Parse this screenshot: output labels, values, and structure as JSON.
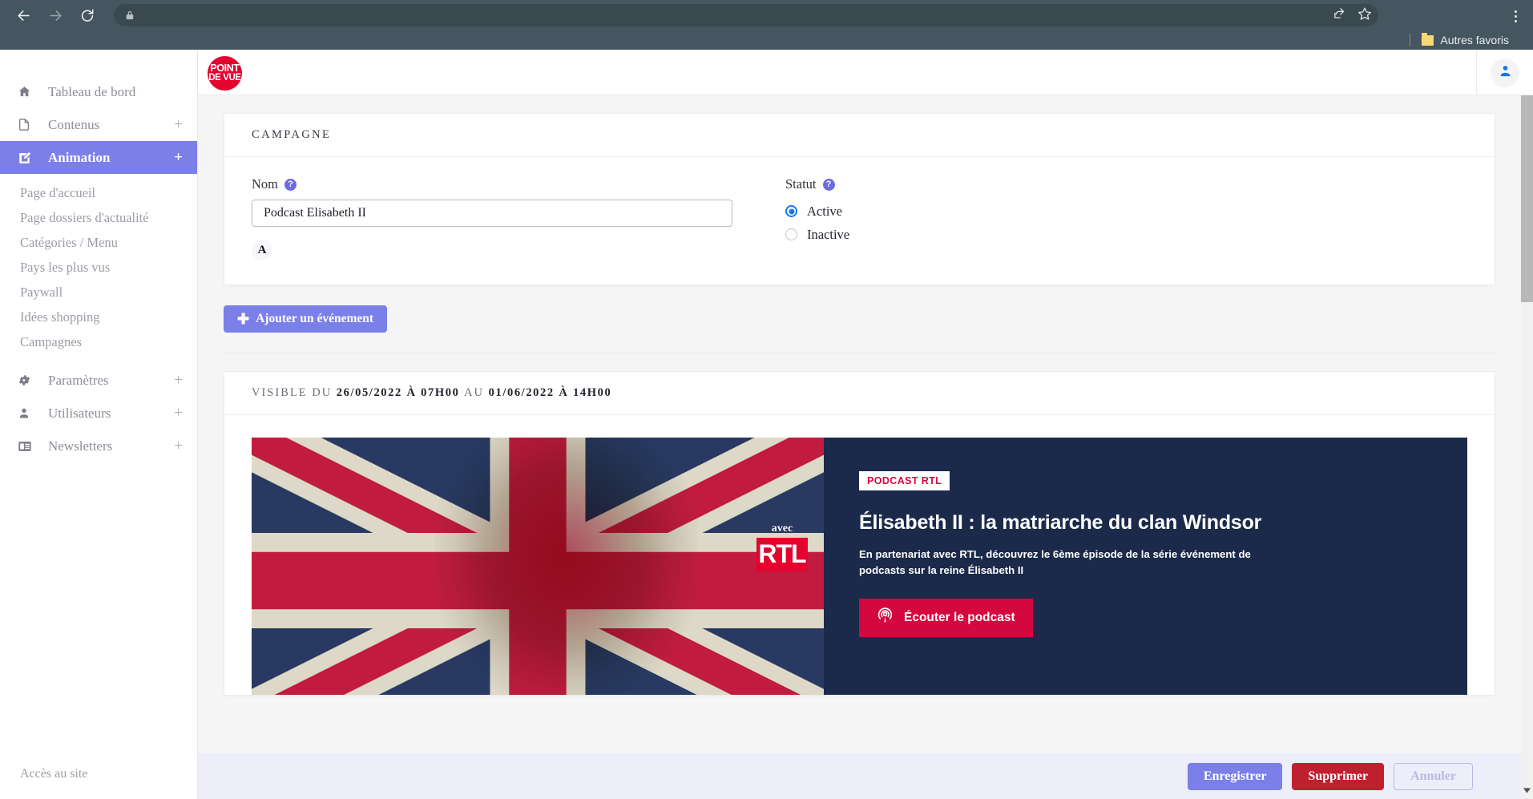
{
  "browser": {
    "back_icon": "back-arrow-icon",
    "forward_icon": "forward-arrow-icon",
    "reload_icon": "reload-icon",
    "lock_icon": "lock-icon",
    "url_value": "",
    "url_placeholder": "",
    "share_icon": "share-icon",
    "bookmark_icon": "star-icon",
    "menu_icon": "kebab-menu-icon",
    "bookmarks": {
      "other_favorites_label": "Autres favoris",
      "folder_icon": "folder-icon"
    }
  },
  "header": {
    "logo_line1": "POINT",
    "logo_line2": "DE VUE",
    "avatar_icon": "user-avatar-icon"
  },
  "sidebar": {
    "items": [
      {
        "label": "Tableau de bord",
        "icon": "home-icon",
        "expandable": false,
        "active": false
      },
      {
        "label": "Contenus",
        "icon": "document-icon",
        "expandable": true,
        "active": false
      },
      {
        "label": "Animation",
        "icon": "edit-square-icon",
        "expandable": true,
        "active": true
      },
      {
        "label": "Paramètres",
        "icon": "gear-icon",
        "expandable": true,
        "active": false
      },
      {
        "label": "Utilisateurs",
        "icon": "user-icon",
        "expandable": true,
        "active": false
      },
      {
        "label": "Newsletters",
        "icon": "newsletter-icon",
        "expandable": true,
        "active": false
      }
    ],
    "animation_subitems": [
      "Page d'accueil",
      "Page dossiers d'actualité",
      "Catégories / Menu",
      "Pays les plus vus",
      "Paywall",
      "Idées shopping",
      "Campagnes"
    ],
    "expand_symbol": "+",
    "site_access_label": "Accès au site"
  },
  "campaign": {
    "section_title": "CAMPAGNE",
    "name_label": "Nom",
    "name_help": "?",
    "name_value": "Podcast Elisabeth II",
    "name_placeholder": "",
    "format_button_label": "A",
    "status_label": "Statut",
    "status_help": "?",
    "status_options": [
      {
        "label": "Active",
        "selected": true
      },
      {
        "label": "Inactive",
        "selected": false
      }
    ],
    "add_event_label": "Ajouter un événement",
    "add_event_plus": "✚"
  },
  "event": {
    "visible_prefix": "VISIBLE DU",
    "visible_start_date": "26/05/2022",
    "visible_a_1": "À",
    "visible_start_time": "07H00",
    "visible_au": "AU",
    "visible_end_date": "01/06/2022",
    "visible_a_2": "À",
    "visible_end_time": "14H00",
    "banner": {
      "image_alt": "union-jack-elisabeth-portrait",
      "partner_avec": "avec",
      "partner_logo": "RTL",
      "tag": "PODCAST RTL",
      "title": "Élisabeth II : la matriarche du clan Windsor",
      "description": "En partenariat avec RTL, découvrez le 6ème épisode de la série événement de podcasts sur la reine Élisabeth II",
      "cta_label": "Écouter le podcast",
      "cta_icon": "podcast-microphone-icon"
    }
  },
  "footer": {
    "save_label": "Enregistrer",
    "delete_label": "Supprimer",
    "cancel_label": "Annuler"
  },
  "colors": {
    "accent_purple": "#7b7fe8",
    "brand_red": "#e4032e",
    "danger_red": "#bf2030",
    "banner_navy": "#1b2a4a",
    "cta_crimson": "#d4073f",
    "chrome_slate": "#465661"
  }
}
